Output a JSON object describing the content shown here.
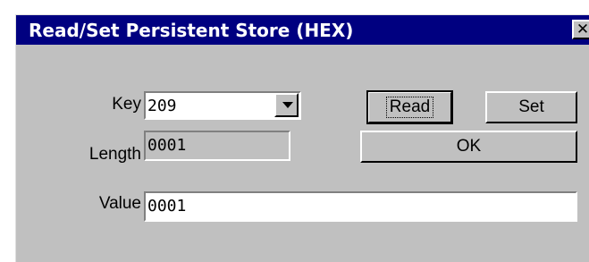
{
  "window": {
    "title": "Read/Set Persistent Store (HEX)",
    "close_glyph": "✕"
  },
  "form": {
    "key_label": "Key",
    "key_value": "209",
    "length_label": "Length",
    "length_value": "0001",
    "value_label": "Value",
    "value_value": "0001"
  },
  "buttons": {
    "read_label": "Read",
    "set_label": "Set",
    "ok_label": "OK"
  },
  "icons": {
    "close": "close-icon",
    "dropdown": "chevron-down-icon"
  },
  "colors": {
    "title_bar": "#000080",
    "face": "#c0c0c0"
  }
}
